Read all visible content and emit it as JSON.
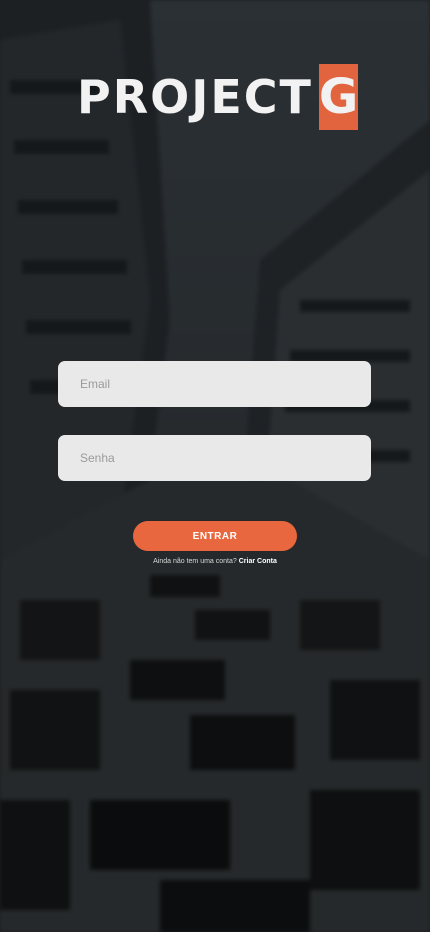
{
  "logo": {
    "text": "PROJECT",
    "mark": "G",
    "mark_color": "#e2643e"
  },
  "form": {
    "email_placeholder": "Email",
    "password_placeholder": "Senha",
    "submit_label": "ENTRAR",
    "submit_color": "#e8673f"
  },
  "register": {
    "prompt": "Ainda não tem uma conta?",
    "link_label": "Criar Conta"
  },
  "background": {
    "dominant_color": "#1c2023",
    "description_icon": "building-facade-background"
  }
}
